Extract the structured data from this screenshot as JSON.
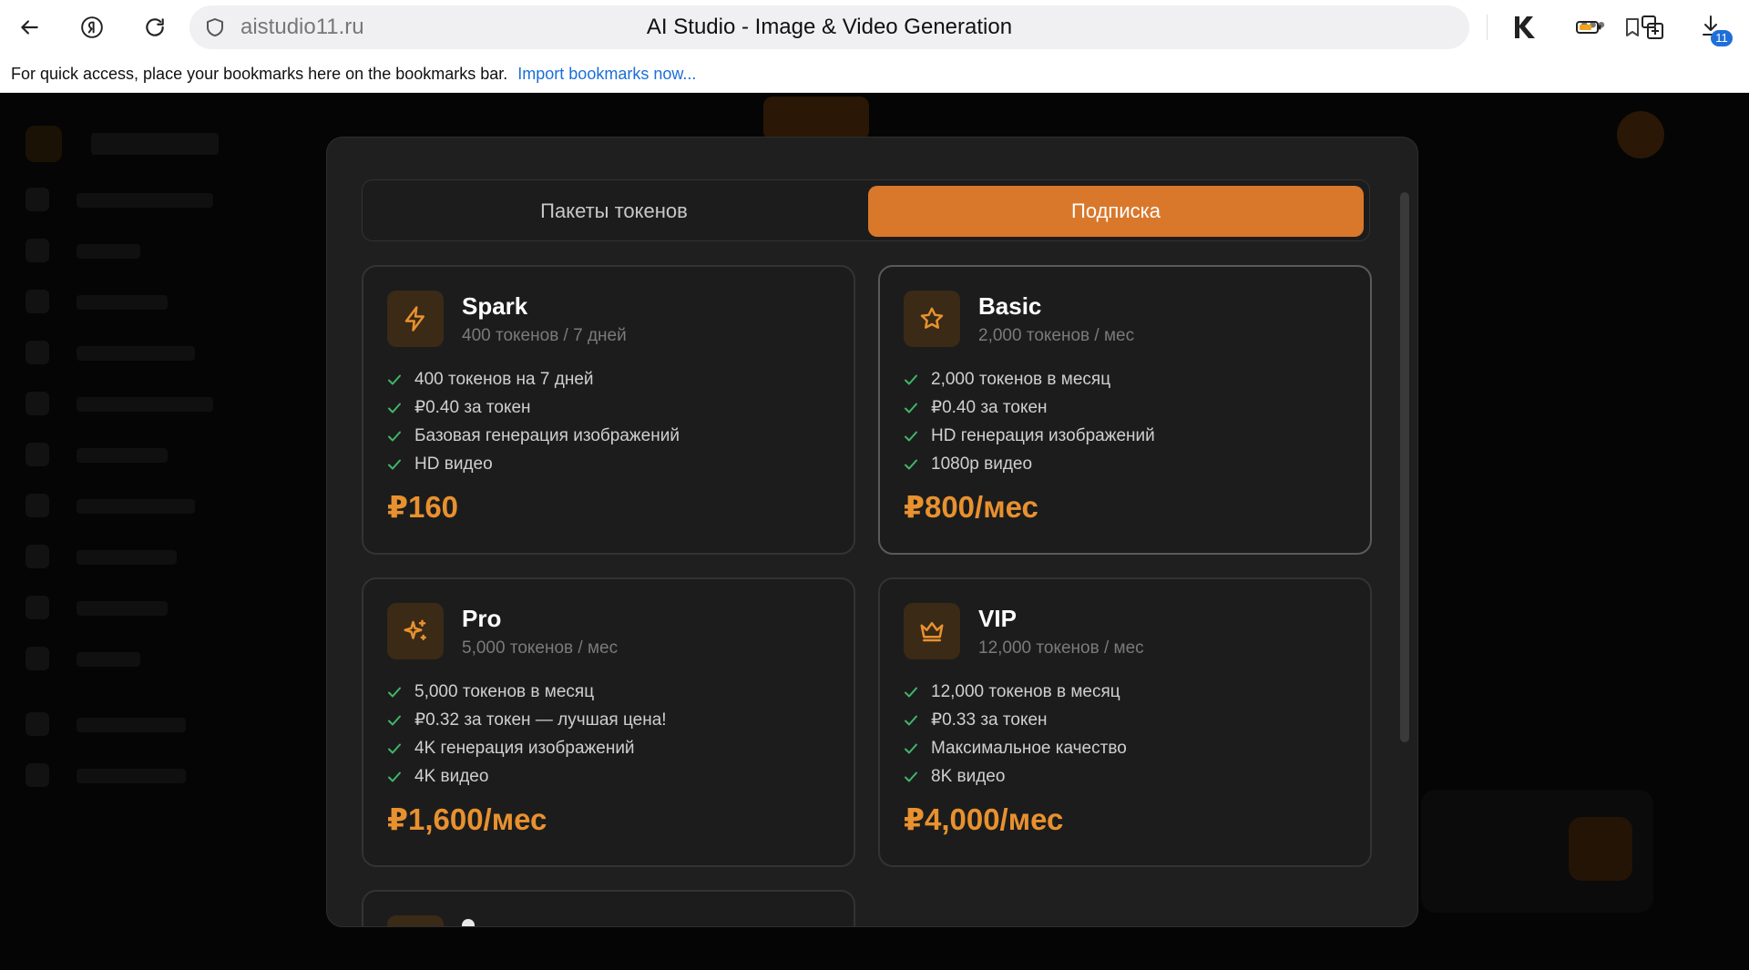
{
  "browser": {
    "url": "aistudio11.ru",
    "page_title": "AI Studio - Image & Video Generation",
    "more_label": "•••",
    "download_count": "11"
  },
  "bookmarks_bar": {
    "message": "For quick access, place your bookmarks here on the bookmarks bar.",
    "import_link": "Import bookmarks now..."
  },
  "modal": {
    "tabs": [
      {
        "label": "Пакеты токенов",
        "active": false
      },
      {
        "label": "Подписка",
        "active": true
      }
    ],
    "plans": [
      {
        "name": "Spark",
        "subtitle": "400 токенов / 7 дней",
        "icon": "lightning-icon",
        "features": [
          "400 токенов на 7 дней",
          "₽0.40 за токен",
          "Базовая генерация изображений",
          "HD видео"
        ],
        "price": "₽160",
        "selected": false
      },
      {
        "name": "Basic",
        "subtitle": "2,000 токенов / мес",
        "icon": "star-icon",
        "features": [
          "2,000 токенов в месяц",
          "₽0.40 за токен",
          "HD генерация изображений",
          "1080p видео"
        ],
        "price": "₽800/мес",
        "selected": true
      },
      {
        "name": "Pro",
        "subtitle": "5,000 токенов / мес",
        "icon": "sparkles-icon",
        "features": [
          "5,000 токенов в месяц",
          "₽0.32 за токен — лучшая цена!",
          "4K генерация изображений",
          "4K видео"
        ],
        "price": "₽1,600/мес",
        "selected": false
      },
      {
        "name": "VIP",
        "subtitle": "12,000 токенов / мес",
        "icon": "crown-icon",
        "features": [
          "12,000 токенов в месяц",
          "₽0.33 за токен",
          "Максимальное качество",
          "8K видео"
        ],
        "price": "₽4,000/мес",
        "selected": false
      }
    ]
  },
  "colors": {
    "accent": "#d9782b",
    "price": "#e8912f",
    "check": "#3fb66a",
    "modal_bg": "#1f1f1f"
  }
}
